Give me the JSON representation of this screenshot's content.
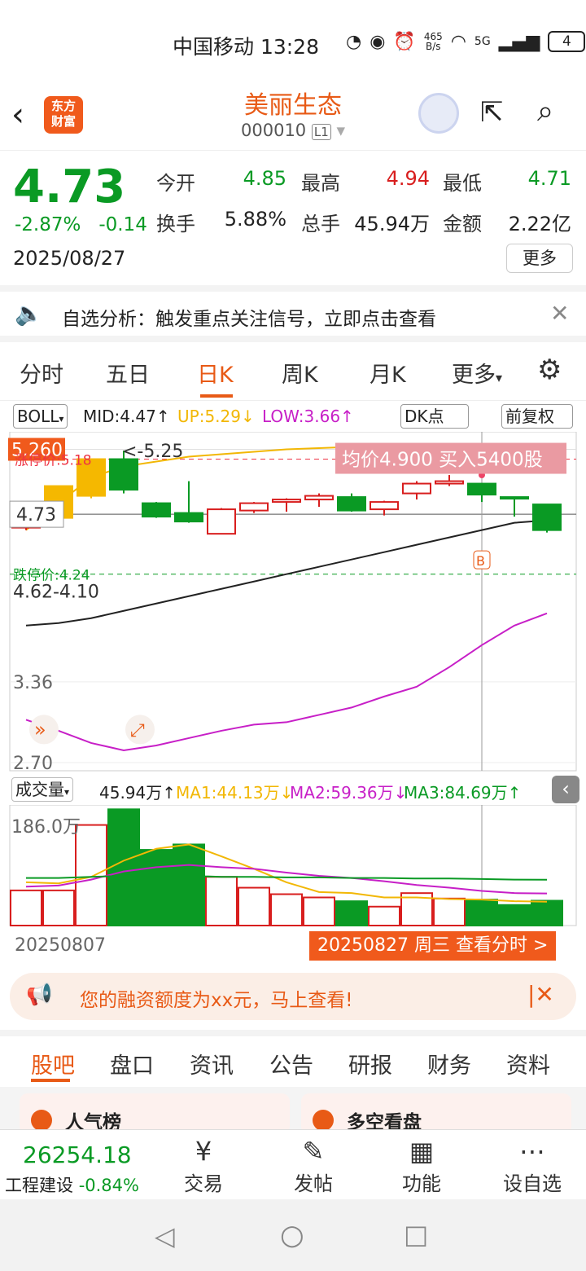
{
  "status": {
    "carrier_time": "中国移动 13:28",
    "net_speed_top": "465",
    "net_speed_unit": "B/s",
    "net_type": "5G",
    "battery": "4"
  },
  "header": {
    "logo_line1": "东方",
    "logo_line2": "财富",
    "stock_name": "美丽生态",
    "stock_code": "000010",
    "level_badge": "L1"
  },
  "quote": {
    "price": "4.73",
    "pct_change": "-2.87%",
    "abs_change": "-0.14",
    "date": "2025/08/27",
    "fields": [
      {
        "label": "今开",
        "value": "4.85",
        "color": "green"
      },
      {
        "label": "最高",
        "value": "4.94",
        "color": "red"
      },
      {
        "label": "最低",
        "value": "4.71",
        "color": "green"
      },
      {
        "label": "换手",
        "value": "5.88%",
        "color": "black"
      },
      {
        "label": "总手",
        "value": "45.94万",
        "color": "black"
      },
      {
        "label": "金额",
        "value": "2.22亿",
        "color": "black"
      }
    ],
    "more": "更多"
  },
  "notice": {
    "text": "自选分析：触发重点关注信号，立即点击查看"
  },
  "tabs": [
    "分时",
    "五日",
    "日K",
    "周K",
    "月K",
    "更多"
  ],
  "active_tab": "日K",
  "chart_bar": {
    "indicator": "BOLL",
    "mid": "MID:4.47↑",
    "up": "UP:5.29↓",
    "low": "LOW:3.66↑",
    "dk": "DK点",
    "fq": "前复权"
  },
  "chart_labels": {
    "y_top": "5.260",
    "limit_up": "涨停价:5.18",
    "high_mark": "<-5.25",
    "current": "4.73",
    "limit_down": "跌停价:4.24",
    "low_mark": "4.62-4.10",
    "y_mid": "3.36",
    "y_bot": "2.70",
    "avg_buy": "均价4.900  买入5400股",
    "b_marker": "B"
  },
  "volume_bar": {
    "label": "成交量",
    "value": "45.94万↑",
    "ma1": "MA1:44.13万↓",
    "ma2": "MA2:59.36万↓",
    "ma3": "MA3:84.69万↑",
    "y_top": "186.0万"
  },
  "x_axis": {
    "start": "20250807",
    "end_tag": "20250827 周三 查看分时 >"
  },
  "banner": {
    "text": "您的融资额度为xx元，马上查看!"
  },
  "bottom_tabs": [
    "股吧",
    "盘口",
    "资讯",
    "公告",
    "研报",
    "财务",
    "资料"
  ],
  "cards": {
    "left": "人气榜",
    "right": "多空看盘"
  },
  "bottom_bar": {
    "index_value": "26254.18",
    "index_name": "工程建设",
    "index_change": "-0.84%",
    "items": [
      "交易",
      "发帖",
      "功能",
      "设自选"
    ]
  },
  "colors": {
    "accent": "#e85a16",
    "up": "#d81e1e",
    "down": "#0a9a24",
    "boll_up": "#f2b705",
    "boll_low": "#c71fc7"
  },
  "chart_data": {
    "type": "candlestick",
    "candles": [
      {
        "o": 4.62,
        "c": 4.7,
        "h": 4.7,
        "l": 4.6,
        "dir": "up"
      },
      {
        "o": 4.7,
        "c": 4.96,
        "h": 4.96,
        "l": 4.7,
        "dir": "up-limit"
      },
      {
        "o": 4.88,
        "c": 5.18,
        "h": 5.18,
        "l": 4.86,
        "dir": "up-limit"
      },
      {
        "o": 5.18,
        "c": 4.93,
        "h": 5.25,
        "l": 4.9,
        "dir": "down"
      },
      {
        "o": 4.82,
        "c": 4.71,
        "h": 4.83,
        "l": 4.7,
        "dir": "down"
      },
      {
        "o": 4.74,
        "c": 4.67,
        "h": 5.0,
        "l": 4.66,
        "dir": "down"
      },
      {
        "o": 4.57,
        "c": 4.77,
        "h": 4.78,
        "l": 4.57,
        "dir": "up"
      },
      {
        "o": 4.76,
        "c": 4.82,
        "h": 4.83,
        "l": 4.74,
        "dir": "up"
      },
      {
        "o": 4.83,
        "c": 4.85,
        "h": 4.86,
        "l": 4.75,
        "dir": "up"
      },
      {
        "o": 4.85,
        "c": 4.88,
        "h": 4.9,
        "l": 4.79,
        "dir": "up"
      },
      {
        "o": 4.87,
        "c": 4.76,
        "h": 4.9,
        "l": 4.75,
        "dir": "down"
      },
      {
        "o": 4.77,
        "c": 4.83,
        "h": 4.84,
        "l": 4.72,
        "dir": "up"
      },
      {
        "o": 4.9,
        "c": 4.98,
        "h": 5.0,
        "l": 4.85,
        "dir": "up"
      },
      {
        "o": 4.98,
        "c": 5.0,
        "h": 5.05,
        "l": 4.96,
        "dir": "up"
      },
      {
        "o": 4.98,
        "c": 4.89,
        "h": 4.98,
        "l": 4.83,
        "dir": "down"
      },
      {
        "o": 4.87,
        "c": 4.86,
        "h": 4.87,
        "l": 4.71,
        "dir": "down"
      },
      {
        "o": 4.81,
        "c": 4.6,
        "h": 4.81,
        "l": 4.58,
        "dir": "down"
      }
    ],
    "boll_mid": [
      3.82,
      3.84,
      3.88,
      3.94,
      4.0,
      4.06,
      4.12,
      4.18,
      4.24,
      4.3,
      4.36,
      4.42,
      4.48,
      4.54,
      4.6,
      4.66,
      4.68
    ],
    "boll_up": [
      4.6,
      4.82,
      5.03,
      5.12,
      5.16,
      5.2,
      5.22,
      5.24,
      5.26,
      5.27,
      5.28,
      5.29,
      5.3,
      5.3,
      5.29,
      5.29,
      5.29
    ],
    "boll_low": [
      3.05,
      2.96,
      2.86,
      2.8,
      2.84,
      2.9,
      2.96,
      3.01,
      3.03,
      3.09,
      3.15,
      3.24,
      3.32,
      3.48,
      3.66,
      3.82,
      3.92
    ],
    "volume": [
      {
        "v": 65,
        "dir": "up"
      },
      {
        "v": 65,
        "dir": "up"
      },
      {
        "v": 186,
        "dir": "up"
      },
      {
        "v": 215,
        "dir": "down"
      },
      {
        "v": 140,
        "dir": "down"
      },
      {
        "v": 150,
        "dir": "down"
      },
      {
        "v": 90,
        "dir": "up"
      },
      {
        "v": 70,
        "dir": "up"
      },
      {
        "v": 58,
        "dir": "up"
      },
      {
        "v": 52,
        "dir": "up"
      },
      {
        "v": 45,
        "dir": "down"
      },
      {
        "v": 35,
        "dir": "up"
      },
      {
        "v": 60,
        "dir": "up"
      },
      {
        "v": 50,
        "dir": "up"
      },
      {
        "v": 48,
        "dir": "down"
      },
      {
        "v": 38,
        "dir": "down"
      },
      {
        "v": 45.94,
        "dir": "down"
      }
    ],
    "vol_ma1": [
      80,
      78,
      90,
      120,
      142,
      150,
      128,
      105,
      80,
      62,
      60,
      52,
      52,
      49,
      48,
      45,
      44.13
    ],
    "vol_ma2": [
      72,
      74,
      85,
      100,
      108,
      112,
      108,
      105,
      98,
      92,
      88,
      82,
      75,
      70,
      64,
      60,
      59.36
    ],
    "vol_ma3": [
      88,
      88,
      90,
      92,
      92,
      92,
      90,
      90,
      89,
      89,
      88,
      88,
      87,
      87,
      86,
      85,
      84.69
    ],
    "price_range": [
      2.62,
      5.35
    ],
    "volume_range": [
      0,
      220
    ]
  }
}
